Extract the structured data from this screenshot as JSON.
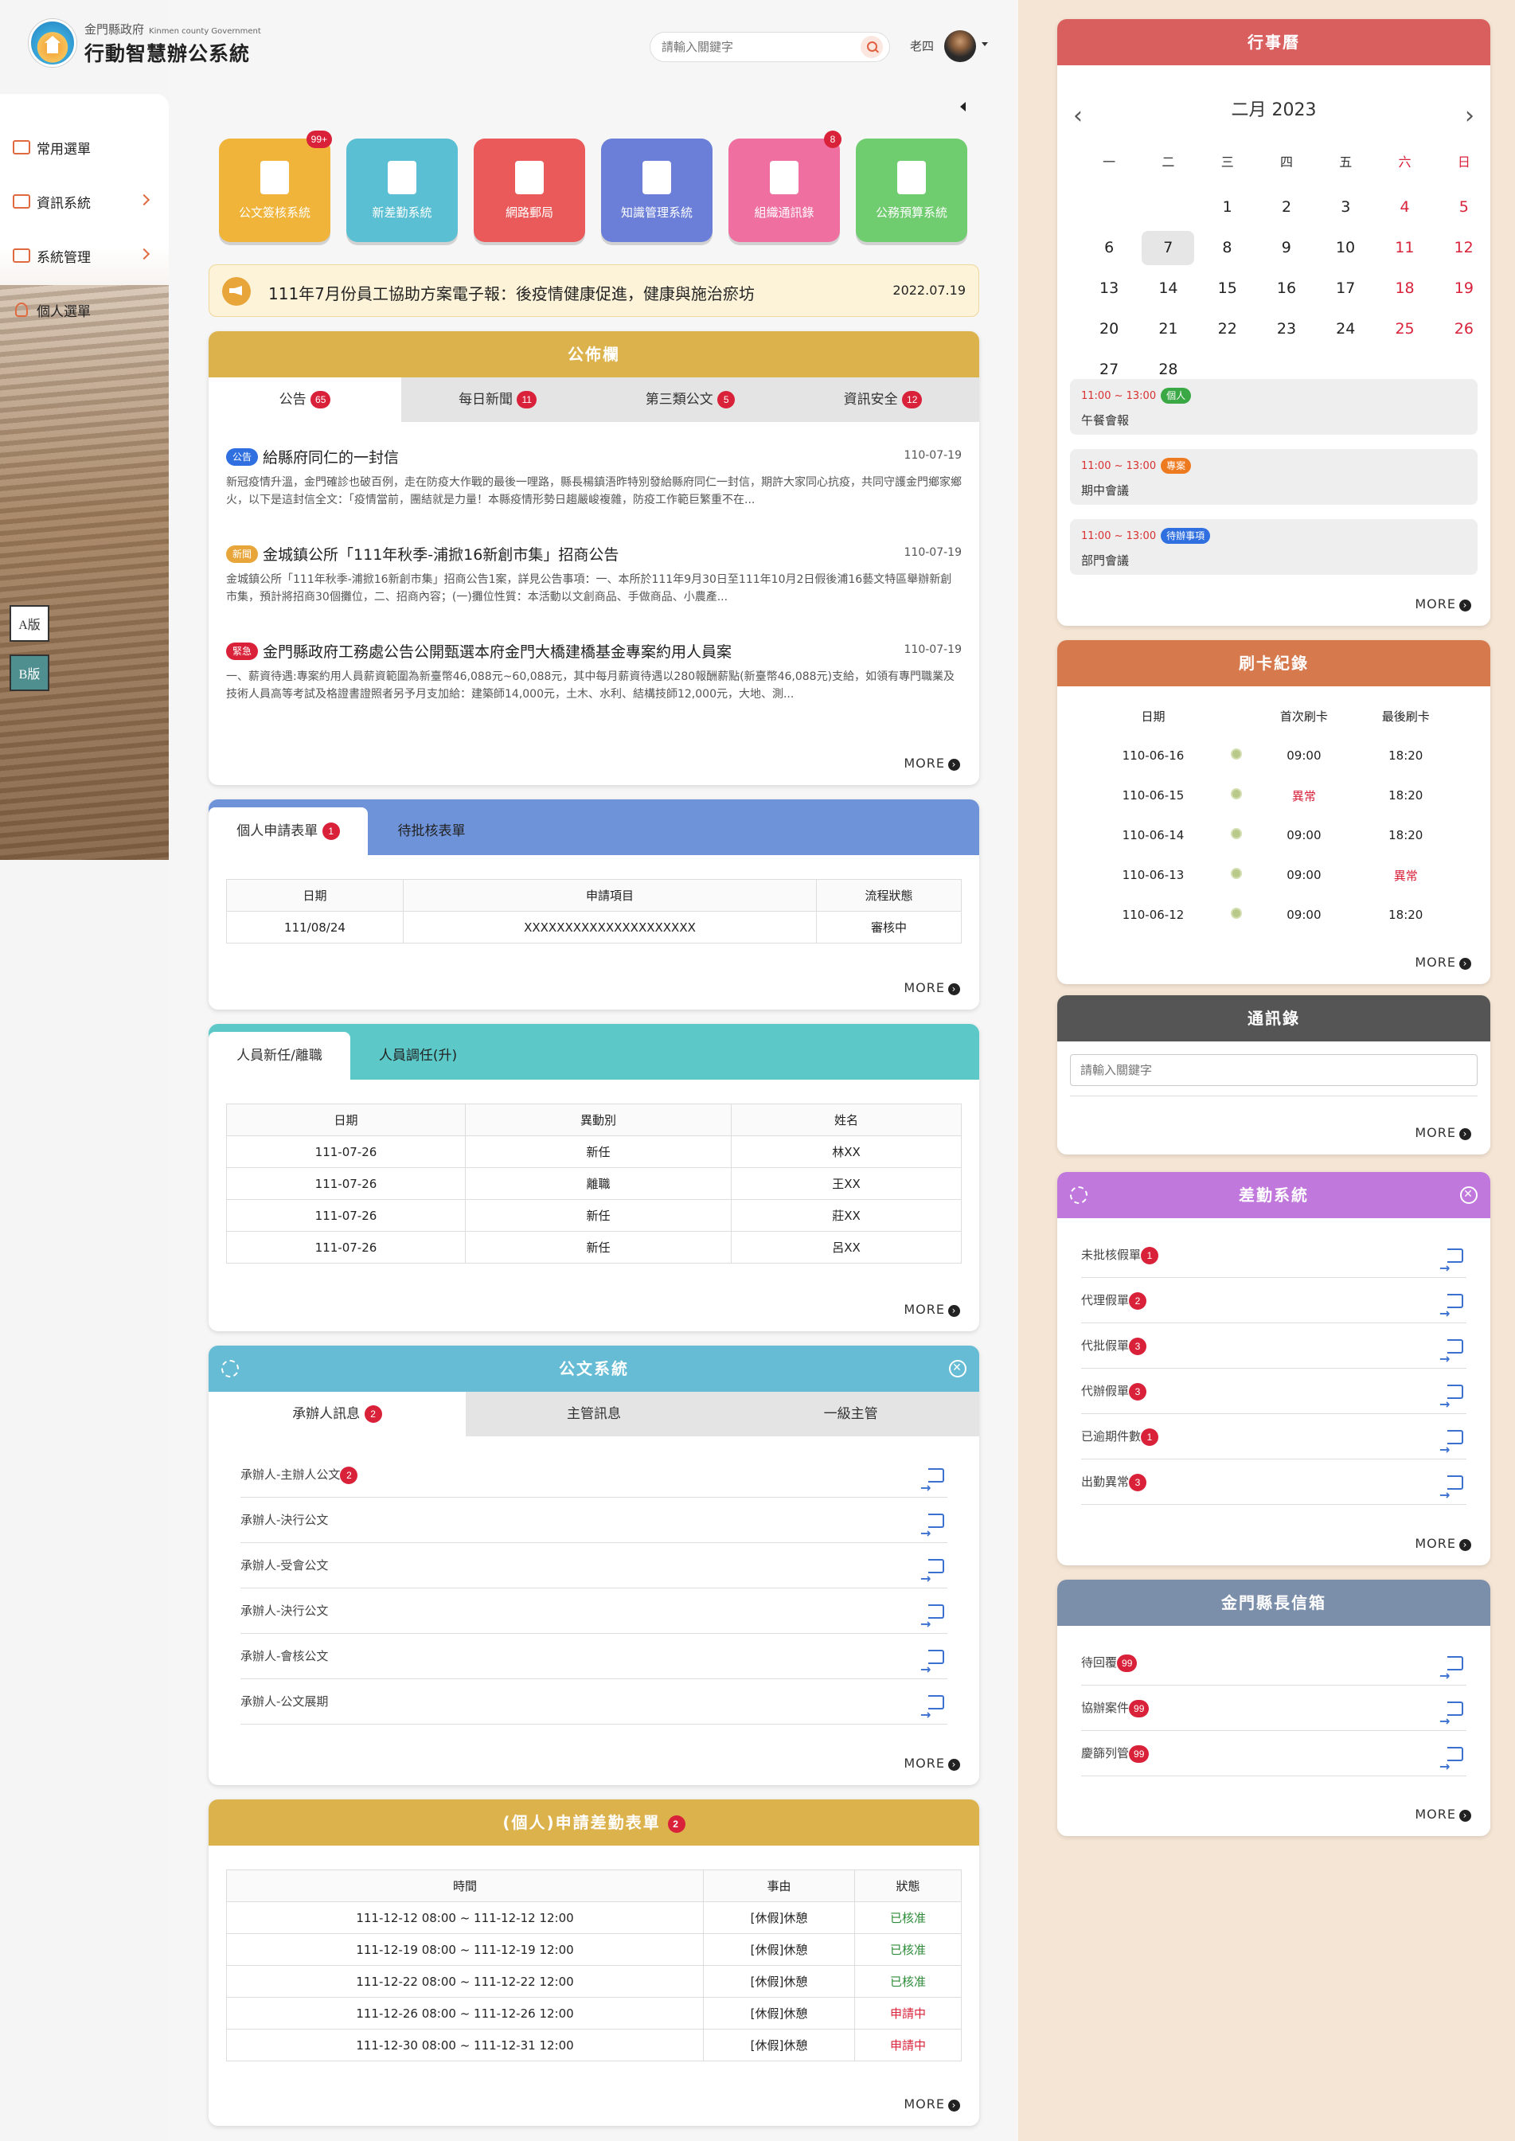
{
  "header": {
    "org": "金門縣政府",
    "org_en": "Kinmen county Government",
    "title": "行動智慧辦公系統",
    "search_placeholder": "請輸入關鍵字",
    "user": "老四"
  },
  "sidebar": {
    "items": [
      {
        "label": "常用選單"
      },
      {
        "label": "資訊系統"
      },
      {
        "label": "系統管理"
      },
      {
        "label": "個人選單"
      }
    ],
    "version_a": "A版",
    "version_b": "B版"
  },
  "quick": [
    {
      "label": "公文簽核系統",
      "badge": "99+",
      "color": "#f0b43a"
    },
    {
      "label": "新差勤系統",
      "badge": "",
      "color": "#5bbfd3"
    },
    {
      "label": "網路郵局",
      "badge": "",
      "color": "#ea5a5a"
    },
    {
      "label": "知識管理系統",
      "badge": "",
      "color": "#6b7fd8"
    },
    {
      "label": "組織通訊錄",
      "badge": "8",
      "color": "#ee6fa0"
    },
    {
      "label": "公務預算系統",
      "badge": "",
      "color": "#6fcc6f"
    }
  ],
  "announcement": {
    "text": "111年7月份員工協助方案電子報：後疫情健康促進，健康與施治瘀坊",
    "date": "2022.07.19"
  },
  "bulletin": {
    "title": "公佈欄",
    "tabs": [
      {
        "label": "公告",
        "count": "65"
      },
      {
        "label": "每日新聞",
        "count": "11"
      },
      {
        "label": "第三類公文",
        "count": "5"
      },
      {
        "label": "資訊安全",
        "count": "12"
      }
    ],
    "news": [
      {
        "tag": "公告",
        "tag_color": "#2f6fe0",
        "title": "給縣府同仁的一封信",
        "date": "110-07-19",
        "body": "新冠疫情升溫，金門確診也破百例，走在防疫大作戰的最後一哩路，縣長楊鎮浯昨特別發給縣府同仁一封信，期許大家同心抗疫，共同守護金門鄉家鄉火，以下是這封信全文：「疫情當前，團結就是力量！本縣疫情形勢日趨嚴峻複雜，防疫工作範巨繁重不在..."
      },
      {
        "tag": "新聞",
        "tag_color": "#e8a53a",
        "title": "金城鎮公所「111年秋季-浦掀16新創市集」招商公告",
        "date": "110-07-19",
        "body": "金城鎮公所「111年秋季-浦掀16新創市集」招商公告1案，詳見公告事項：一、本所於111年9月30日至111年10月2日假後浦16藝文特區舉辦新創市集，預計將招商30個攤位，二、招商內容；(一)攤位性質：本活動以文創商品、手做商品、小農產..."
      },
      {
        "tag": "緊急",
        "tag_color": "#d9223a",
        "title": "金門縣政府工務處公告公開甄選本府金門大橋建橋基金專案約用人員案",
        "date": "110-07-19",
        "body": "一、薪資待遇:專案約用人員薪資範圍為新臺幣46,088元~60,088元，其中每月薪資待遇以280報酬薪點(新臺幣46,088元)支給，如領有專門職業及技術人員高等考試及格證書證照者另予月支加給：建築師14,000元，土木、水利、結構技師12,000元，大地、測..."
      }
    ],
    "more": "MORE"
  },
  "personal_forms": {
    "tabs": [
      {
        "label": "個人申請表單",
        "count": "1"
      },
      {
        "label": "待批核表單",
        "count": ""
      }
    ],
    "columns": [
      "日期",
      "申請項目",
      "流程狀態"
    ],
    "rows": [
      [
        "111/08/24",
        "XXXXXXXXXXXXXXXXXXXXX",
        "審核中"
      ]
    ],
    "more": "MORE"
  },
  "staff": {
    "tabs": [
      "人員新任/離職",
      "人員調任(升)"
    ],
    "columns": [
      "日期",
      "異動別",
      "姓名"
    ],
    "rows": [
      [
        "111-07-26",
        "新任",
        "林XX"
      ],
      [
        "111-07-26",
        "離職",
        "王XX"
      ],
      [
        "111-07-26",
        "新任",
        "莊XX"
      ],
      [
        "111-07-26",
        "新任",
        "呂XX"
      ]
    ],
    "more": "MORE"
  },
  "docs": {
    "title": "公文系統",
    "tabs": [
      {
        "label": "承辦人訊息",
        "count": "2"
      },
      {
        "label": "主管訊息",
        "count": ""
      },
      {
        "label": "一級主管",
        "count": ""
      }
    ],
    "items": [
      {
        "label": "承辦人-主辦人公文",
        "count": "2"
      },
      {
        "label": "承辦人-決行公文",
        "count": ""
      },
      {
        "label": "承辦人-受會公文",
        "count": ""
      },
      {
        "label": "承辦人-決行公文",
        "count": ""
      },
      {
        "label": "承辦人-會核公文",
        "count": ""
      },
      {
        "label": "承辦人-公文展期",
        "count": ""
      }
    ],
    "more": "MORE"
  },
  "leave": {
    "title": "(個人)申請差勤表單",
    "count": "2",
    "columns": [
      "時間",
      "事由",
      "狀態"
    ],
    "rows": [
      [
        "111-12-12 08:00 ~ 111-12-12 12:00",
        "[休假]休憩",
        "已核准"
      ],
      [
        "111-12-19 08:00 ~ 111-12-19 12:00",
        "[休假]休憩",
        "已核准"
      ],
      [
        "111-12-22 08:00 ~ 111-12-22 12:00",
        "[休假]休憩",
        "已核准"
      ],
      [
        "111-12-26 08:00 ~ 111-12-26 12:00",
        "[休假]休憩",
        "申請中"
      ],
      [
        "111-12-30 08:00 ~ 111-12-31 12:00",
        "[休假]休憩",
        "申請中"
      ]
    ],
    "more": "MORE"
  },
  "calendar": {
    "title": "行事曆",
    "month": "二月 2023",
    "weekdays": [
      "一",
      "二",
      "三",
      "四",
      "五",
      "六",
      "日"
    ],
    "weeks": [
      [
        "",
        "",
        "1",
        "2",
        "3",
        "4",
        "5"
      ],
      [
        "6",
        "7",
        "8",
        "9",
        "10",
        "11",
        "12"
      ],
      [
        "13",
        "14",
        "15",
        "16",
        "17",
        "18",
        "19"
      ],
      [
        "20",
        "21",
        "22",
        "23",
        "24",
        "25",
        "26"
      ],
      [
        "27",
        "28",
        "",
        "",
        "",
        "",
        ""
      ]
    ],
    "today": "7",
    "events": [
      {
        "time": "11:00 ~ 13:00",
        "tag": "個人",
        "tag_color": "#3aa845",
        "name": "午餐會報"
      },
      {
        "time": "11:00 ~ 13:00",
        "tag": "專案",
        "tag_color": "#ee7a20",
        "name": "期中會議"
      },
      {
        "time": "11:00 ~ 13:00",
        "tag": "待辦事項",
        "tag_color": "#2f6fe0",
        "name": "部門會議"
      }
    ],
    "more": "MORE"
  },
  "punch": {
    "title": "刷卡紀錄",
    "columns": [
      "日期",
      "首次刷卡",
      "最後刷卡"
    ],
    "rows": [
      [
        "110-06-16",
        "09:00",
        "18:20"
      ],
      [
        "110-06-15",
        "異常",
        "18:20"
      ],
      [
        "110-06-14",
        "09:00",
        "18:20"
      ],
      [
        "110-06-13",
        "09:00",
        "異常"
      ],
      [
        "110-06-12",
        "09:00",
        "18:20"
      ]
    ],
    "more": "MORE"
  },
  "contacts": {
    "title": "通訊錄",
    "placeholder": "請輸入關鍵字",
    "more": "MORE"
  },
  "attendance": {
    "title": "差勤系統",
    "items": [
      {
        "label": "未批核假單",
        "count": "1"
      },
      {
        "label": "代理假單",
        "count": "2"
      },
      {
        "label": "代批假單",
        "count": "3"
      },
      {
        "label": "代辦假單",
        "count": "3"
      },
      {
        "label": "已逾期件數",
        "count": "1"
      },
      {
        "label": "出勤異常",
        "count": "3"
      }
    ],
    "more": "MORE"
  },
  "mailbox": {
    "title": "金門縣長信箱",
    "items": [
      {
        "label": "待回覆",
        "count": "99"
      },
      {
        "label": "協辦案件",
        "count": "99"
      },
      {
        "label": "慶篩列管",
        "count": "99"
      }
    ],
    "more": "MORE"
  },
  "colors": {
    "bulletin": "#dcb24c",
    "forms": "#6e93d8",
    "staff": "#5cc8c8",
    "docs": "#66bcd4",
    "leave": "#dcb24c",
    "calendar": "#d95f5f",
    "punch": "#d67a4e",
    "contacts": "#555555",
    "attendance": "#c178dc",
    "mailbox": "#7b8fab"
  }
}
